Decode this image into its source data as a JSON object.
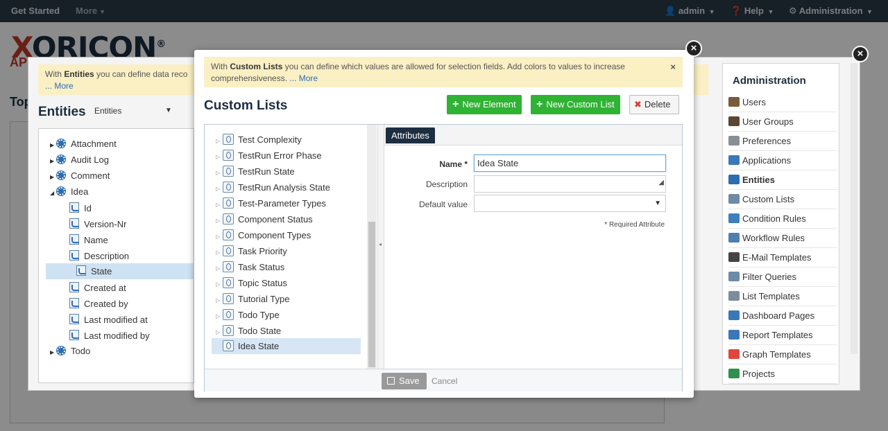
{
  "topbar": {
    "get_started": "Get Started",
    "more": "More",
    "admin": "admin",
    "help": "Help",
    "administration": "Administration"
  },
  "bg": {
    "logo": "XORICON",
    "logo_sub": "AP",
    "top_heading": "Top"
  },
  "entities_dialog": {
    "info_prefix": "With ",
    "info_bold": "Entities",
    "info_text": " you can define data reco",
    "info_more": "... More",
    "title": "Entities",
    "selector": "Entities",
    "tree": [
      {
        "label": "Attachment",
        "level": 0,
        "kind": "entity",
        "expanded": false
      },
      {
        "label": "Audit Log",
        "level": 0,
        "kind": "entity",
        "expanded": false
      },
      {
        "label": "Comment",
        "level": 0,
        "kind": "entity",
        "expanded": false
      },
      {
        "label": "Idea",
        "level": 0,
        "kind": "entity",
        "expanded": true
      },
      {
        "label": "Id",
        "level": 1,
        "kind": "field"
      },
      {
        "label": "Version-Nr",
        "level": 1,
        "kind": "field"
      },
      {
        "label": "Name",
        "level": 1,
        "kind": "field"
      },
      {
        "label": "Description",
        "level": 1,
        "kind": "field"
      },
      {
        "label": "State",
        "level": 1,
        "kind": "field",
        "selected": true
      },
      {
        "label": "Created at",
        "level": 1,
        "kind": "field"
      },
      {
        "label": "Created by",
        "level": 1,
        "kind": "field"
      },
      {
        "label": "Last modified at",
        "level": 1,
        "kind": "field"
      },
      {
        "label": "Last modified by",
        "level": 1,
        "kind": "field"
      },
      {
        "label": "Todo",
        "level": 0,
        "kind": "entity",
        "expanded": false
      }
    ]
  },
  "admin_panel": {
    "title": "Administration",
    "items": [
      {
        "label": "Users",
        "icon": "user-icon",
        "color": "#7a5b3a"
      },
      {
        "label": "User Groups",
        "icon": "user-group-icon",
        "color": "#5a4633"
      },
      {
        "label": "Preferences",
        "icon": "wrench-icon",
        "color": "#8a8f96"
      },
      {
        "label": "Applications",
        "icon": "window-icon",
        "color": "#3a78b8"
      },
      {
        "label": "Entities",
        "icon": "gear-icon",
        "color": "#2c6cb0",
        "active": true
      },
      {
        "label": "Custom Lists",
        "icon": "list-icon",
        "color": "#6d8aa6"
      },
      {
        "label": "Condition Rules",
        "icon": "rule-icon",
        "color": "#3d7fbf"
      },
      {
        "label": "Workflow Rules",
        "icon": "workflow-icon",
        "color": "#4e7fb0"
      },
      {
        "label": "E-Mail Templates",
        "icon": "mail-icon",
        "color": "#444"
      },
      {
        "label": "Filter Queries",
        "icon": "filter-icon",
        "color": "#6d8aa6"
      },
      {
        "label": "List Templates",
        "icon": "list-template-icon",
        "color": "#7b8c9c"
      },
      {
        "label": "Dashboard Pages",
        "icon": "dashboard-icon",
        "color": "#3a78b8"
      },
      {
        "label": "Report Templates",
        "icon": "report-icon",
        "color": "#3a78b8"
      },
      {
        "label": "Graph Templates",
        "icon": "pie-chart-icon",
        "color": "#e0463c"
      },
      {
        "label": "Projects",
        "icon": "project-icon",
        "color": "#2f8f4e"
      }
    ]
  },
  "custom_lists_dialog": {
    "info_prefix": "With ",
    "info_bold": "Custom Lists",
    "info_text": " you can define which values are allowed for selection fields. Add colors to values to increase comprehensiveness. ",
    "info_more": "... More",
    "info_close": "×",
    "title": "Custom Lists",
    "new_element": "New Element",
    "new_custom_list": "New Custom List",
    "delete": "Delete",
    "lists": [
      "Test Complexity",
      "TestRun Error Phase",
      "TestRun State",
      "TestRun Analysis State",
      "Test-Parameter Types",
      "Component Status",
      "Component Types",
      "Task Priority",
      "Task Status",
      "Topic Status",
      "Tutorial Type",
      "Todo Type",
      "Todo State"
    ],
    "selected_list": "Idea State",
    "attributes_tab": "Attributes",
    "form": {
      "name_label": "Name *",
      "name_value": "Idea State",
      "description_label": "Description",
      "description_value": "",
      "default_label": "Default value",
      "default_value": "",
      "required_note": "* Required Attribute"
    },
    "save": "Save",
    "cancel": "Cancel"
  },
  "colors": {
    "primary_dark": "#1c2e40",
    "green": "#2fb332",
    "info_bg": "#fbefc4",
    "selection": "#d6e6f5"
  }
}
